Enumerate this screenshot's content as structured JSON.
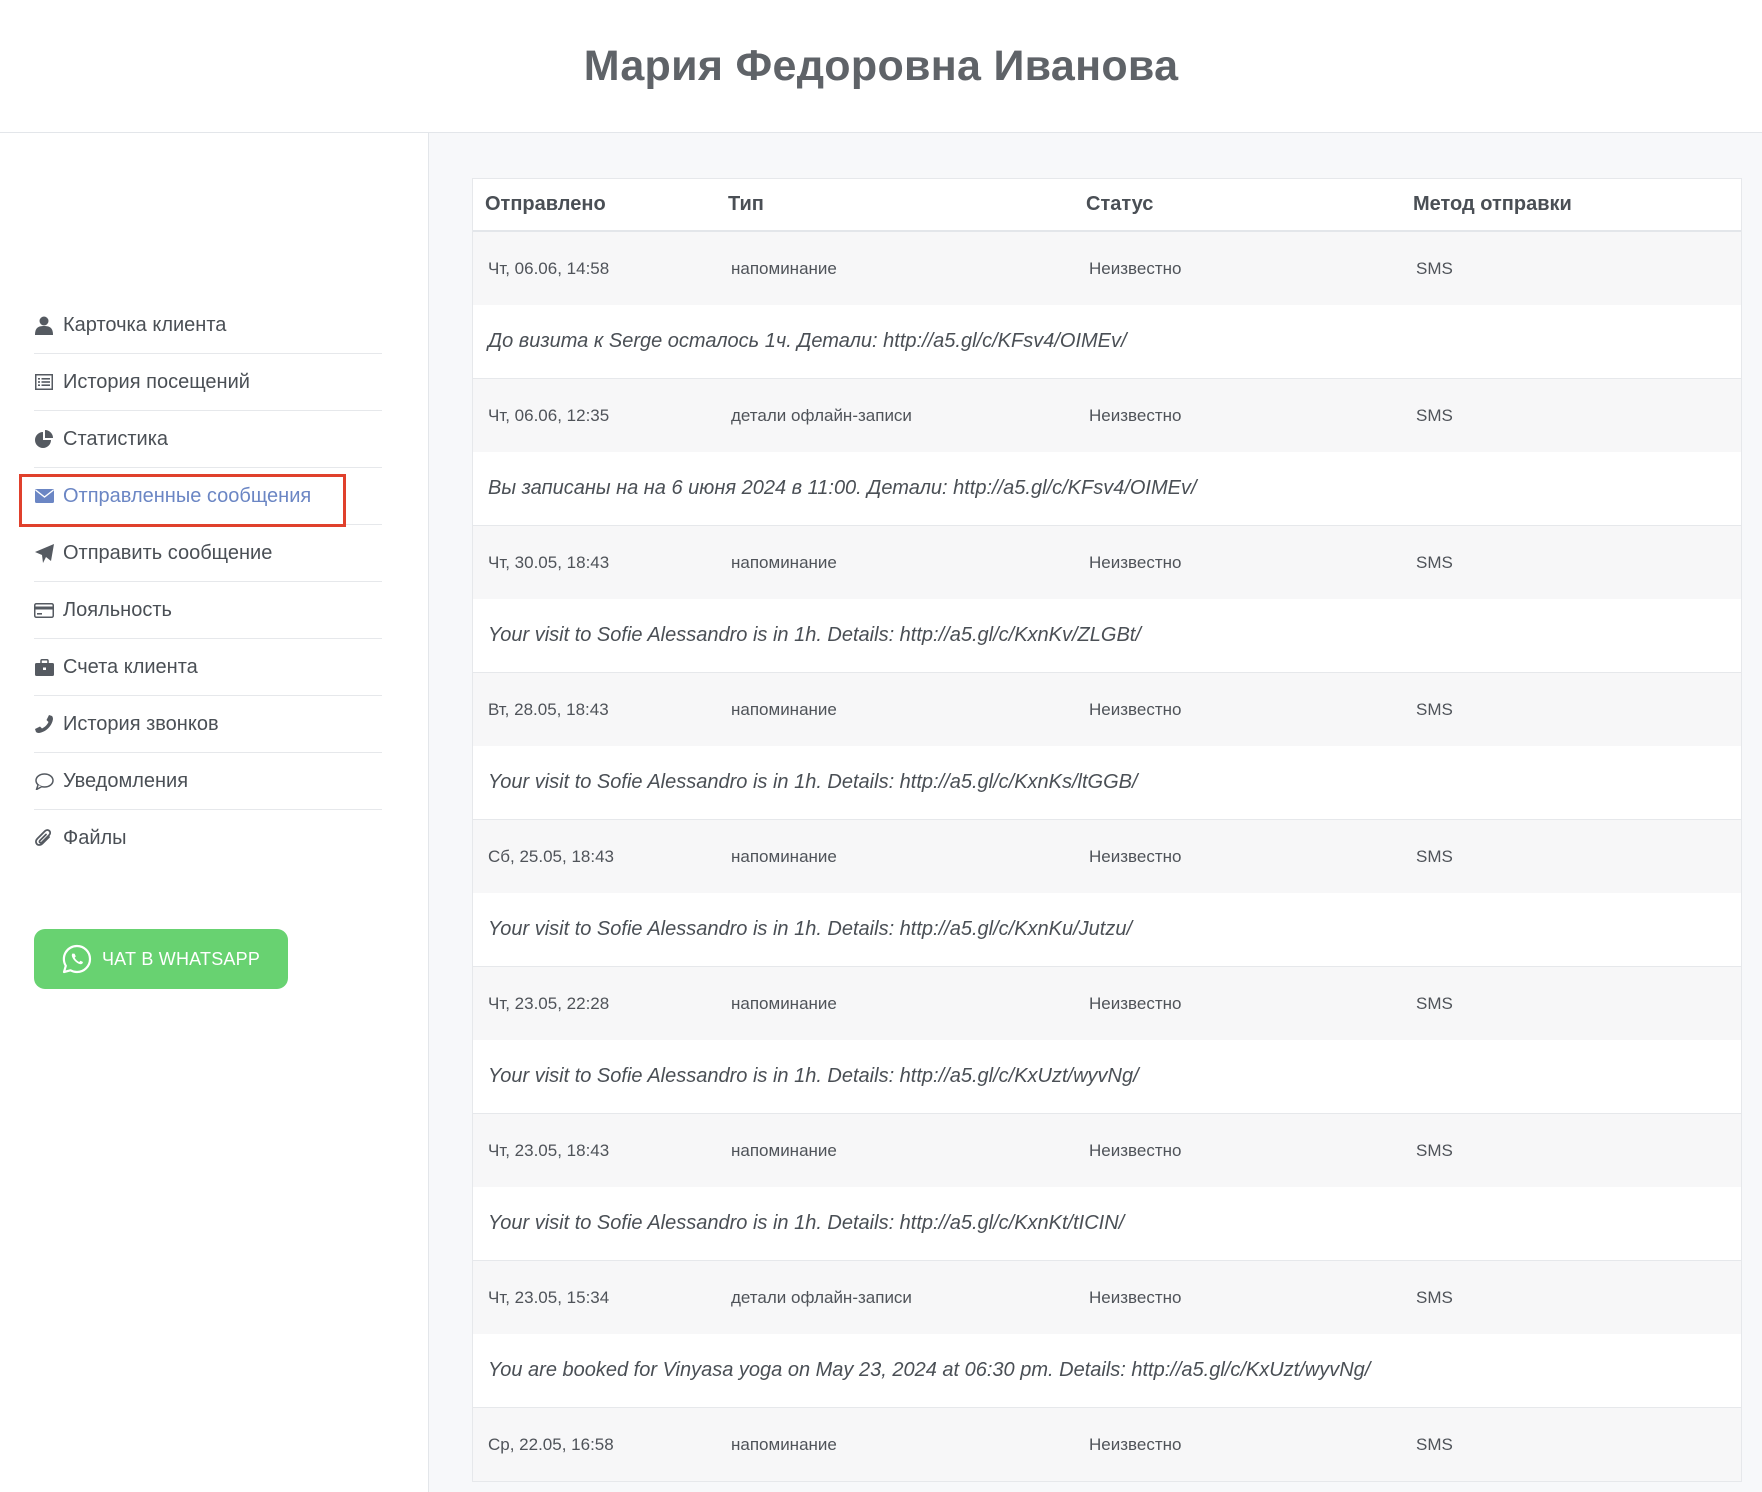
{
  "header": {
    "title": "Мария Федоровна Иванова"
  },
  "sidebar": {
    "items": [
      {
        "label": "Карточка клиента",
        "icon": "user-icon"
      },
      {
        "label": "История посещений",
        "icon": "list-icon"
      },
      {
        "label": "Статистика",
        "icon": "pie-chart-icon"
      },
      {
        "label": "Отправленные сообщения",
        "icon": "envelope-icon",
        "active": true
      },
      {
        "label": "Отправить сообщение",
        "icon": "paper-plane-icon"
      },
      {
        "label": "Лояльность",
        "icon": "credit-card-icon"
      },
      {
        "label": "Счета клиента",
        "icon": "briefcase-icon"
      },
      {
        "label": "История звонков",
        "icon": "phone-icon"
      },
      {
        "label": "Уведомления",
        "icon": "comment-icon"
      },
      {
        "label": "Файлы",
        "icon": "paperclip-icon"
      }
    ],
    "whatsapp_button": {
      "label": "ЧАТ В WHATSAPP",
      "icon": "whatsapp-icon",
      "color": "#68d271"
    },
    "active_color": "#6b86c4",
    "highlight_color": "#e0402c"
  },
  "table": {
    "headers": [
      "Отправлено",
      "Тип",
      "Статус",
      "Метод отправки"
    ],
    "rows": [
      {
        "sent": "Чт, 06.06, 14:58",
        "type": "напоминание",
        "status": "Неизвестно",
        "method": "SMS",
        "message": "До визита к Serge осталось 1ч. Детали: http://a5.gl/c/KFsv4/OIMEv/"
      },
      {
        "sent": "Чт, 06.06, 12:35",
        "type": "детали офлайн-записи",
        "status": "Неизвестно",
        "method": "SMS",
        "message": "Вы записаны на на 6 июня 2024 в 11:00. Детали: http://a5.gl/c/KFsv4/OIMEv/"
      },
      {
        "sent": "Чт, 30.05, 18:43",
        "type": "напоминание",
        "status": "Неизвестно",
        "method": "SMS",
        "message": "Your visit to Sofie Alessandro is in 1h. Details: http://a5.gl/c/KxnKv/ZLGBt/"
      },
      {
        "sent": "Вт, 28.05, 18:43",
        "type": "напоминание",
        "status": "Неизвестно",
        "method": "SMS",
        "message": "Your visit to Sofie Alessandro is in 1h. Details: http://a5.gl/c/KxnKs/ltGGB/"
      },
      {
        "sent": "Сб, 25.05, 18:43",
        "type": "напоминание",
        "status": "Неизвестно",
        "method": "SMS",
        "message": "Your visit to Sofie Alessandro is in 1h. Details: http://a5.gl/c/KxnKu/Jutzu/"
      },
      {
        "sent": "Чт, 23.05, 22:28",
        "type": "напоминание",
        "status": "Неизвестно",
        "method": "SMS",
        "message": "Your visit to Sofie Alessandro is in 1h. Details: http://a5.gl/c/KxUzt/wyvNg/"
      },
      {
        "sent": "Чт, 23.05, 18:43",
        "type": "напоминание",
        "status": "Неизвестно",
        "method": "SMS",
        "message": "Your visit to Sofie Alessandro is in 1h. Details: http://a5.gl/c/KxnKt/tICIN/"
      },
      {
        "sent": "Чт, 23.05, 15:34",
        "type": "детали офлайн-записи",
        "status": "Неизвестно",
        "method": "SMS",
        "message": "You are booked for Vinyasa yoga on May 23, 2024 at 06:30 pm. Details: http://a5.gl/c/KxUzt/wyvNg/"
      },
      {
        "sent": "Ср, 22.05, 16:58",
        "type": "напоминание",
        "status": "Неизвестно",
        "method": "SMS",
        "message": ""
      }
    ]
  }
}
